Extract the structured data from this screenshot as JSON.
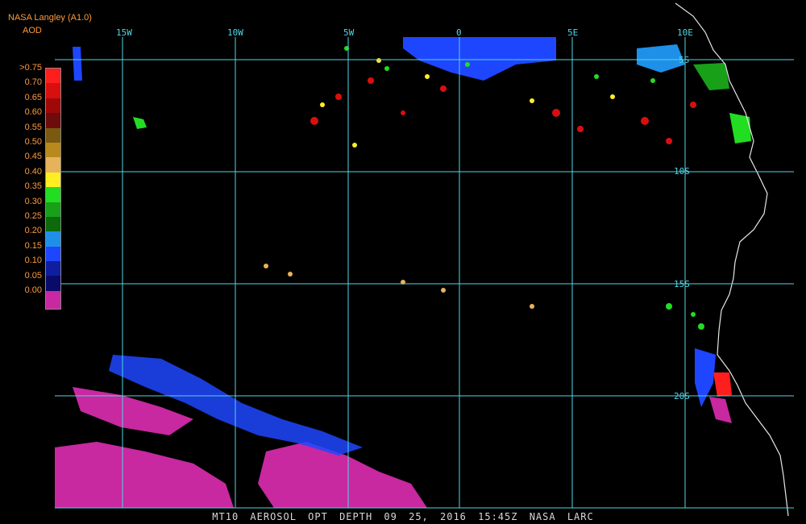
{
  "header": {
    "source": "NASA Langley (A1.0)",
    "product": "AOD"
  },
  "legend": {
    "labels": [
      ">0.75",
      "0.70",
      "0.65",
      "0.60",
      "0.55",
      "0.50",
      "0.45",
      "0.40",
      "0.35",
      "0.30",
      "0.25",
      "0.20",
      "0.15",
      "0.10",
      "0.05",
      "0.00"
    ],
    "colors": [
      "#ff1e1e",
      "#d90f0f",
      "#a00808",
      "#6e0c0c",
      "#7a5a10",
      "#b88a1c",
      "#e8b25a",
      "#ffee22",
      "#22dd22",
      "#18a018",
      "#0c6a0c",
      "#1e90e8",
      "#1e46ff",
      "#0f1ea0",
      "#0a0a6a",
      "#c828a0"
    ]
  },
  "grid": {
    "lon_labels": [
      "15W",
      "10W",
      "5W",
      "0",
      "5E",
      "10E"
    ],
    "lat_labels": [
      "5S",
      "10S",
      "15S",
      "20S"
    ]
  },
  "footer": "MT10  AEROSOL OPT DEPTH  09 25, 2016 15:45Z  NASA LARC"
}
